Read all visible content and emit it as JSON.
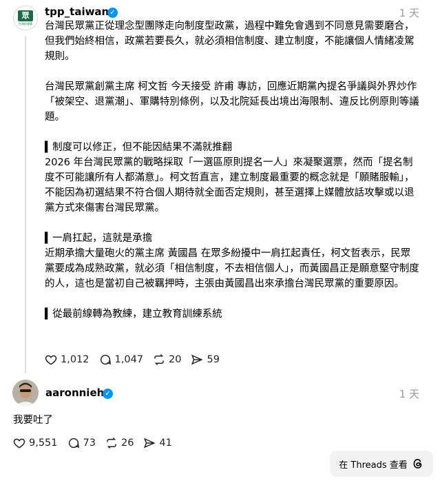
{
  "post": {
    "username": "tpp_taiwan",
    "avatar_text": "眾",
    "avatar_caption": "台灣民眾黨",
    "time": "1 天",
    "paragraphs": [
      "台灣民眾黨正從理念型團隊走向制度型政黨，過程中難免會遇到不同意見需要磨合，但我們始終相信，政黨若要長久，就必須相信制度、建立制度，不能讓個人情緒凌駕規則。",
      "台灣民眾黨創黨主席 柯文哲 今天接受 許甫 專訪，回應近期黨內提名爭議與外界炒作「被架空、退黨潮」、軍購特別條例，以及北院延長出境出海限制、違反比例原則等議題。",
      "▍制度可以修正，但不能因結果不滿就推翻",
      "2026 年台灣民眾黨的戰略採取「一選區原則提名一人」來凝聚選票，然而「提名制度不可能讓所有人都滿意」。柯文哲直言，建立制度最重要的概念就是「願賭服輸」，不能因為初選結果不符合個人期待就全面否定規則，甚至選擇上媒體放話攻擊或以退黨方式來傷害台灣民眾黨。",
      "▍一肩扛起，這就是承擔",
      "近期承擔大量砲火的黨主席 黃國昌 在眾多紛擾中一肩扛起責任，柯文哲表示，民眾黨要成為成熟政黨，就必須「相信制度，不去相信個人」，而黃國昌正是願意堅守制度的人，這也是當初自己被羈押時，主張由黃國昌出來承擔台灣民眾黨的重要原因。",
      "▍從最前線轉為教練，建立教育訓練系統"
    ],
    "likes": "1,012",
    "comments": "1,047",
    "reposts": "20",
    "shares": "59"
  },
  "reply": {
    "username": "aaronnieh",
    "time": "1 天",
    "text": "我要吐了",
    "likes": "9,551",
    "comments": "73",
    "reposts": "26",
    "shares": "41"
  },
  "footer": {
    "view_label": "在 Threads 查看"
  },
  "icons": [
    "verified-icon",
    "heart-icon",
    "comment-icon",
    "repost-icon",
    "share-icon",
    "threads-logo-icon"
  ]
}
